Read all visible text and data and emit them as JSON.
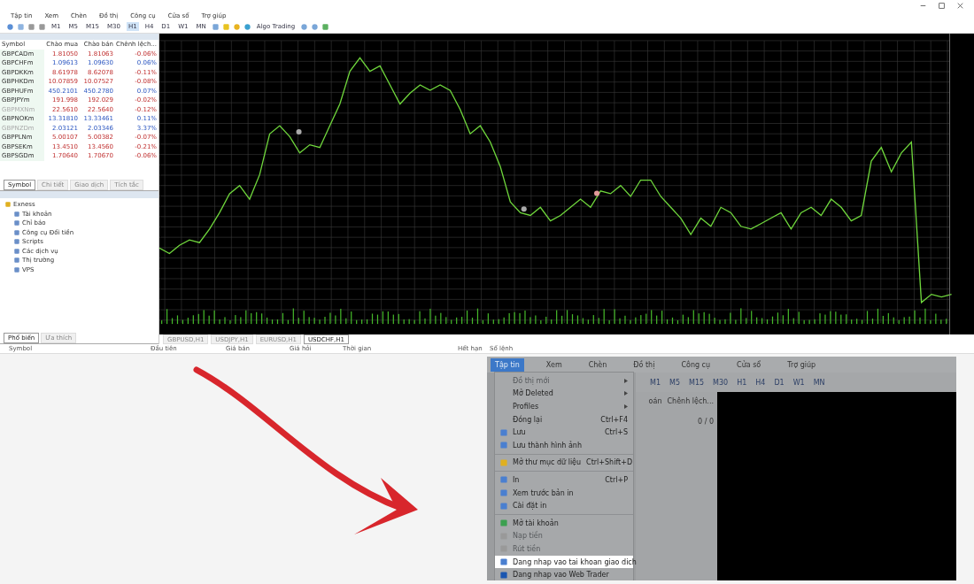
{
  "top_window": {
    "menu": [
      "Tập tin",
      "Xem",
      "Chèn",
      "Đồ thị",
      "Công cụ",
      "Cửa sổ",
      "Trợ giúp"
    ],
    "algo_label": "Algo Trading",
    "timeframes": [
      {
        "label": "M1",
        "selected": false
      },
      {
        "label": "M5",
        "selected": false
      },
      {
        "label": "M15",
        "selected": false
      },
      {
        "label": "M30",
        "selected": false
      },
      {
        "label": "H1",
        "selected": true
      },
      {
        "label": "H4",
        "selected": false
      },
      {
        "label": "D1",
        "selected": false
      },
      {
        "label": "W1",
        "selected": false
      },
      {
        "label": "MN",
        "selected": false
      }
    ],
    "market_watch": {
      "columns": [
        "Symbol",
        "Chào mua",
        "Chào bán",
        "Chênh lệch..."
      ],
      "rows": [
        {
          "symbol": "GBPCADm",
          "bid": "1.81050",
          "ask": "1.81063",
          "change": "-0.06%",
          "up": false,
          "disabled": false
        },
        {
          "symbol": "GBPCHFm",
          "bid": "1.09613",
          "ask": "1.09630",
          "change": "0.06%",
          "up": true,
          "disabled": false
        },
        {
          "symbol": "GBPDKKm",
          "bid": "8.61978",
          "ask": "8.62078",
          "change": "-0.11%",
          "up": false,
          "disabled": false
        },
        {
          "symbol": "GBPHKDm",
          "bid": "10.07859",
          "ask": "10.07527",
          "change": "-0.08%",
          "up": false,
          "disabled": false
        },
        {
          "symbol": "GBPHUFm",
          "bid": "450.2101",
          "ask": "450.2780",
          "change": "0.07%",
          "up": true,
          "disabled": false
        },
        {
          "symbol": "GBPJPYm",
          "bid": "191.998",
          "ask": "192.029",
          "change": "-0.02%",
          "up": false,
          "disabled": false
        },
        {
          "symbol": "GBPMXNm",
          "bid": "22.5610",
          "ask": "22.5640",
          "change": "-0.12%",
          "up": false,
          "disabled": true
        },
        {
          "symbol": "GBPNOKm",
          "bid": "13.31810",
          "ask": "13.33461",
          "change": "0.11%",
          "up": true,
          "disabled": false
        },
        {
          "symbol": "GBPNZDm",
          "bid": "2.03121",
          "ask": "2.03346",
          "change": "3.37%",
          "up": true,
          "disabled": true
        },
        {
          "symbol": "GBPPLNm",
          "bid": "5.00107",
          "ask": "5.00382",
          "change": "-0.07%",
          "up": false,
          "disabled": false
        },
        {
          "symbol": "GBPSEKm",
          "bid": "13.4510",
          "ask": "13.4560",
          "change": "-0.21%",
          "up": false,
          "disabled": false
        },
        {
          "symbol": "GBPSGDm",
          "bid": "1.70640",
          "ask": "1.70670",
          "change": "-0.06%",
          "up": false,
          "disabled": false
        }
      ]
    },
    "navigator": {
      "tabs": [
        {
          "label": "Symbol",
          "selected": true
        },
        {
          "label": "Chi tiết",
          "selected": false
        },
        {
          "label": "Giao dịch",
          "selected": false
        },
        {
          "label": "Tích tắc",
          "selected": false
        }
      ],
      "tree": [
        {
          "label": "Exness",
          "children": [
            {
              "label": "Tài khoản"
            },
            {
              "label": "Chỉ báo"
            },
            {
              "label": "Công cụ Đối tiền"
            },
            {
              "label": "Scripts"
            },
            {
              "label": "Các dịch vụ"
            },
            {
              "label": "Thị trường"
            },
            {
              "label": "VPS"
            }
          ]
        }
      ]
    },
    "left_bottom_tabs": [
      {
        "label": "Phổ biến",
        "selected": true
      },
      {
        "label": "Ưa thích",
        "selected": false
      }
    ],
    "chart_tabs": [
      {
        "label": "GBPUSD,H1",
        "selected": false
      },
      {
        "label": "USDJPY,H1",
        "selected": false
      },
      {
        "label": "EURUSD,H1",
        "selected": false
      },
      {
        "label": "USDCHF,H1",
        "selected": true
      }
    ],
    "toolbox_columns": [
      "Symbol",
      "Đầu tiên",
      "Giá bán",
      "Giá hỏi",
      "Thời gian",
      "Hết hạn",
      "Sổ lệnh"
    ]
  },
  "zoomed": {
    "menu": [
      {
        "label": "Tập tin",
        "selected": true
      },
      {
        "label": "Xem",
        "selected": false
      },
      {
        "label": "Chèn",
        "selected": false
      },
      {
        "label": "Đồ thị",
        "selected": false
      },
      {
        "label": "Công cụ",
        "selected": false
      },
      {
        "label": "Cửa sổ",
        "selected": false
      },
      {
        "label": "Trợ giúp",
        "selected": false
      }
    ],
    "timeframes": [
      "M1",
      "M5",
      "M15",
      "M30",
      "H1",
      "H4",
      "D1",
      "W1",
      "MN"
    ],
    "behind_partial": "oán",
    "behind_column": "Chênh lệch...",
    "behind_value": "0 / 0",
    "file_menu": [
      {
        "kind": "item",
        "label": "Đồ thị mới",
        "submenu": true,
        "disabled": true,
        "selected": false
      },
      {
        "kind": "item",
        "label": "Mở Deleted",
        "submenu": true,
        "disabled": false,
        "selected": false
      },
      {
        "kind": "item",
        "label": "Profiles",
        "submenu": true,
        "disabled": false,
        "selected": false
      },
      {
        "kind": "item",
        "label": "Đóng lại",
        "shortcut": "Ctrl+F4",
        "disabled": false,
        "selected": false
      },
      {
        "kind": "item",
        "label": "Lưu",
        "shortcut": "Ctrl+S",
        "disabled": false,
        "selected": false
      },
      {
        "kind": "item",
        "label": "Lưu thành hình ảnh",
        "disabled": false,
        "selected": false
      },
      {
        "kind": "separator"
      },
      {
        "kind": "item",
        "label": "Mở thư mục dữ liệu",
        "shortcut": "Ctrl+Shift+D",
        "disabled": false,
        "selected": false
      },
      {
        "kind": "separator"
      },
      {
        "kind": "item",
        "label": "In",
        "shortcut": "Ctrl+P",
        "disabled": false,
        "selected": false
      },
      {
        "kind": "item",
        "label": "Xem trước bản in",
        "disabled": false,
        "selected": false
      },
      {
        "kind": "item",
        "label": "Cài đặt in",
        "disabled": false,
        "selected": false
      },
      {
        "kind": "separator"
      },
      {
        "kind": "item",
        "label": "Mở tài khoản",
        "disabled": false,
        "selected": false
      },
      {
        "kind": "item",
        "label": "Nạp tiền",
        "disabled": true,
        "selected": false
      },
      {
        "kind": "item",
        "label": "Rút tiền",
        "disabled": true,
        "selected": false
      },
      {
        "kind": "item",
        "label": "Dang nhap vao tai khoan giao dich",
        "disabled": false,
        "selected": true
      },
      {
        "kind": "item",
        "label": "Dang nhap vao Web Trader",
        "disabled": false,
        "selected": false
      }
    ]
  }
}
